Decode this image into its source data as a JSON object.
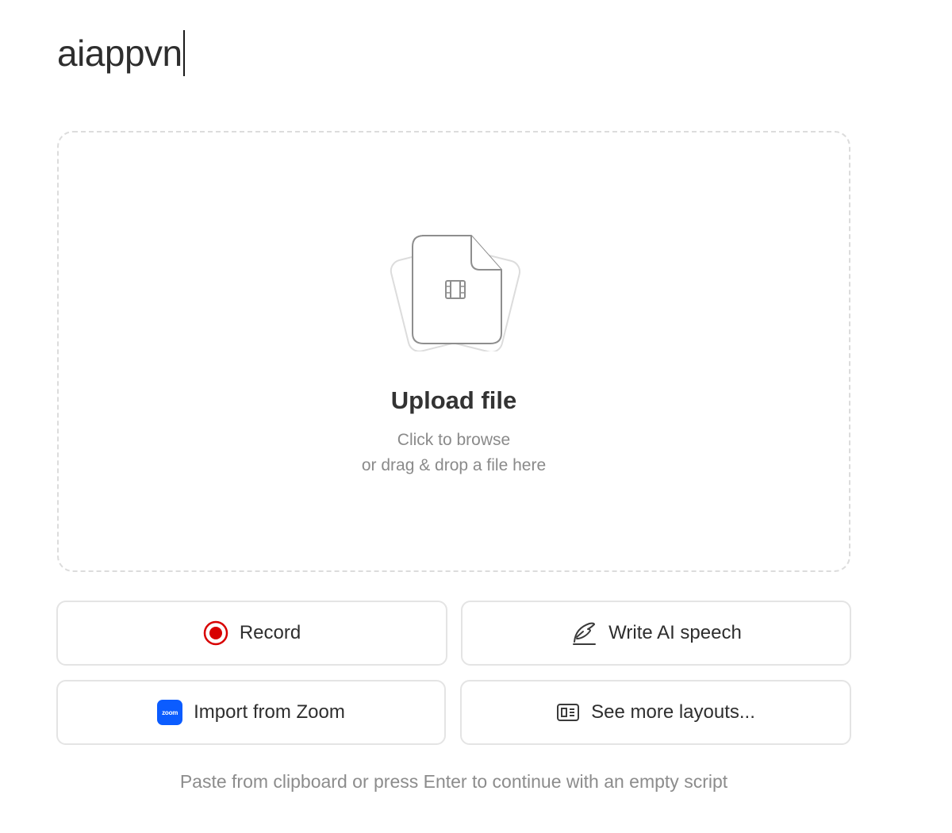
{
  "title": {
    "value": "aiappvn"
  },
  "upload": {
    "title": "Upload file",
    "line1": "Click to browse",
    "line2": "or drag & drop a file here",
    "icon": "video-file-icon"
  },
  "actions": {
    "record": {
      "label": "Record",
      "icon": "record-icon",
      "color": "#d80000"
    },
    "write_ai": {
      "label": "Write AI speech",
      "icon": "quill-pen-icon"
    },
    "zoom": {
      "label": "Import from Zoom",
      "icon": "zoom-logo-icon",
      "badge_text": "zoom",
      "color": "#0b5cff"
    },
    "layouts": {
      "label": "See more layouts...",
      "icon": "layout-icon"
    }
  },
  "footer": {
    "hint": "Paste from clipboard or press Enter to continue with an empty script"
  }
}
